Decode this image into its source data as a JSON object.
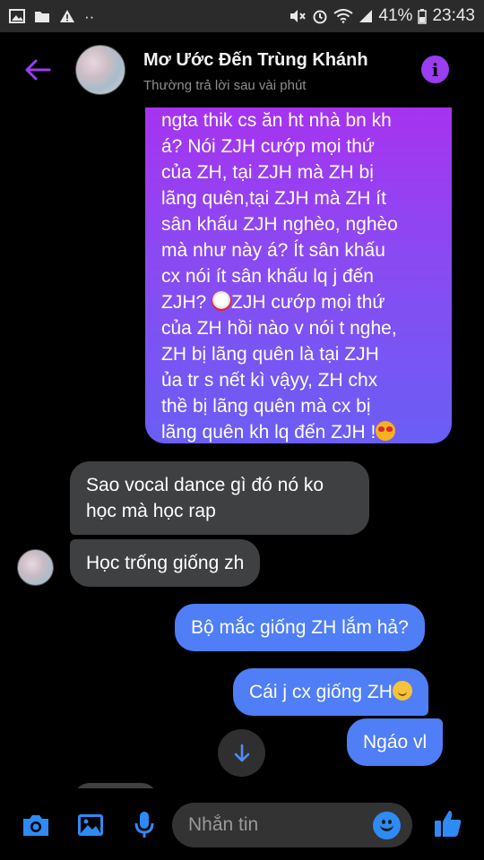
{
  "status_bar": {
    "battery": "41%",
    "time": "23:43",
    "icons": [
      "image-icon",
      "folder-icon",
      "warning-icon",
      "more-dots-icon",
      "mute-icon",
      "alarm-icon",
      "wifi-icon",
      "signal-icon",
      "battery-icon"
    ]
  },
  "header": {
    "contact_name": "Mơ Ước Đến Trùng Khánh",
    "contact_status": "Thường trả lời sau vài phút",
    "icons": {
      "back": "back-arrow-icon",
      "info": "info-icon"
    },
    "accent_color": "#9b3df0"
  },
  "messages": {
    "outgoing_long": {
      "lines": [
        "ngta thik cs ăn ht nhà bn kh",
        "á? Nói ZJH cướp mọi thứ",
        "của ZH, tại ZJH mà ZH bị",
        "lãng quên,tại ZJH mà ZH ít",
        "sân khấu ZJH nghèo, nghèo",
        "mà như này á? Ít sân khấu",
        "cx nói ít sân khấu lq j đến",
        "ZJH? ",
        "ZJH cướp mọi thứ",
        "của ZH hồi nào v nói t nghe,",
        "ZH bị lãng quên là tại ZJH",
        "ủa tr s nết kì vậyy, ZH chx",
        "thề bị lãng quên mà cx bị",
        "lãng quên kh lq đến ZJH !"
      ],
      "emojis": [
        "clown-emoji",
        "heart-eyes-emoji"
      ]
    },
    "incoming_1_line_1": "Sao vocal dance gì đó nó ko",
    "incoming_1_line_2": "học mà học rap",
    "incoming_2": "Học trống giống zh",
    "outgoing_1": "Bộ mắc giống ZH lắm hả?",
    "outgoing_2": "Cái j cx giống ZH",
    "outgoing_2_emoji": "relieved-emoji",
    "outgoing_3": "Ngáo vl",
    "colors": {
      "incoming": "#3e4042",
      "outgoing": "#4f7ef6",
      "gradient_top": "#a633f0",
      "gradient_bottom": "#6a5ef5"
    }
  },
  "composer": {
    "placeholder": "Nhắn tin",
    "icons": [
      "camera-icon",
      "gallery-icon",
      "microphone-icon",
      "emoji-icon",
      "thumbs-up-icon"
    ],
    "icon_color": "#2e8af5"
  }
}
